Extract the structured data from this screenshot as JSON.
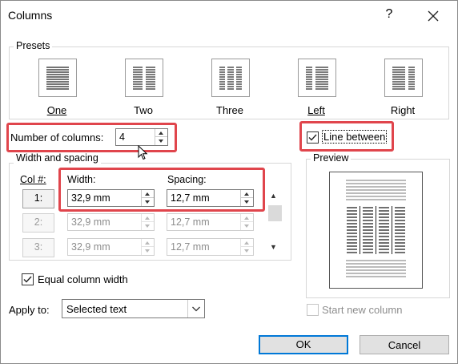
{
  "window": {
    "title": "Columns",
    "help": "?",
    "close_icon": "close-icon"
  },
  "presets": {
    "label": "Presets",
    "items": [
      {
        "label": "One",
        "icon": "preset-one-icon"
      },
      {
        "label": "Two",
        "icon": "preset-two-icon"
      },
      {
        "label": "Three",
        "icon": "preset-three-icon"
      },
      {
        "label": "Left",
        "icon": "preset-left-icon"
      },
      {
        "label": "Right",
        "icon": "preset-right-icon"
      }
    ]
  },
  "number_of_columns": {
    "label": "Number of columns:",
    "value": "4"
  },
  "line_between": {
    "label": "Line between",
    "checked": true
  },
  "width_spacing": {
    "label": "Width and spacing",
    "col_header": "Col #:",
    "width_header": "Width:",
    "spacing_header": "Spacing:",
    "rows": [
      {
        "col": "1:",
        "width": "32,9 mm",
        "spacing": "12,7 mm",
        "enabled": true
      },
      {
        "col": "2:",
        "width": "32,9 mm",
        "spacing": "12,7 mm",
        "enabled": false
      },
      {
        "col": "3:",
        "width": "32,9 mm",
        "spacing": "12,7 mm",
        "enabled": false
      }
    ],
    "scroll_up": "▲",
    "scroll_down": "▼"
  },
  "equal_column_width": {
    "label": "Equal column width",
    "checked": true
  },
  "preview": {
    "label": "Preview",
    "columns": 4
  },
  "apply_to": {
    "label": "Apply to:",
    "value": "Selected text"
  },
  "start_new_column": {
    "label": "Start new column",
    "checked": false,
    "enabled": false
  },
  "buttons": {
    "ok": "OK",
    "cancel": "Cancel"
  },
  "colors": {
    "highlight": "#e0454c",
    "focus": "#0078d7"
  }
}
